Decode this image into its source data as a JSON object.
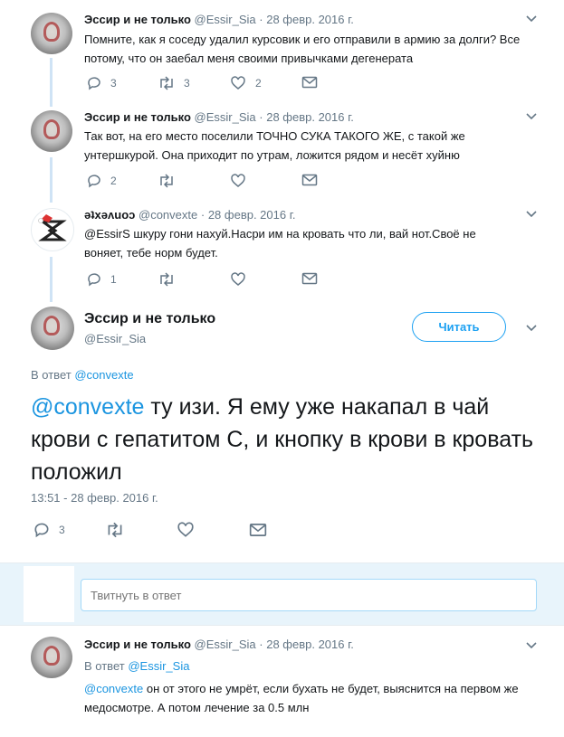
{
  "tweets": [
    {
      "name": "Эссир и не только",
      "handle": "@Essir_Sia",
      "date": "28 февр. 2016 г.",
      "text": "Помните, как я соседу удалил курсовик и его отправили в армию за долги? Все потому, что он заебал меня своими привычками дегенерата",
      "replies": "3",
      "retweets": "3",
      "likes": "2"
    },
    {
      "name": "Эссир и не только",
      "handle": "@Essir_Sia",
      "date": "28 февр. 2016 г.",
      "text": "Так вот, на его место поселили ТОЧНО СУКА ТАКОГО ЖЕ, с такой же унтершкурой. Она приходит по утрам, ложится рядом и несёт хуйню",
      "replies": "2",
      "retweets": "",
      "likes": ""
    },
    {
      "name": "ǝʇxǝʌuoɔ",
      "handle": "@convexte",
      "date": "28 февр. 2016 г.",
      "text": "@EssirS шкуру гони нахуй.Насри им на кровать что ли, вай нот.Своё не воняет, тебе норм будет.",
      "replies": "1",
      "retweets": "",
      "likes": ""
    }
  ],
  "main": {
    "name": "Эссир и не только",
    "handle": "@Essir_Sia",
    "follow_label": "Читать",
    "reply_to_prefix": "В ответ",
    "reply_to_handle": "@convexte",
    "mention": "@convexte",
    "text": " ту изи. Я ему уже накапал в чай крови с гепатитом С, и кнопку в крови в кровать положил",
    "timestamp": "13:51 - 28 февр. 2016 г.",
    "replies": "3"
  },
  "reply_box": {
    "placeholder": "Твитнуть в ответ"
  },
  "last": {
    "name": "Эссир и не только",
    "handle": "@Essir_Sia",
    "date": "28 февр. 2016 г.",
    "reply_to_prefix": "В ответ",
    "reply_to_handle": "@Essir_Sia",
    "mention": "@convexte",
    "text": " он от этого не умрёт, если бухать не будет, выяснится на первом же медосмотре. А потом лечение за 0.5 млн"
  },
  "colors": {
    "accent": "#1b95e0",
    "muted": "#657786",
    "border": "#e6ecf0",
    "thread": "#cfe3f5"
  }
}
